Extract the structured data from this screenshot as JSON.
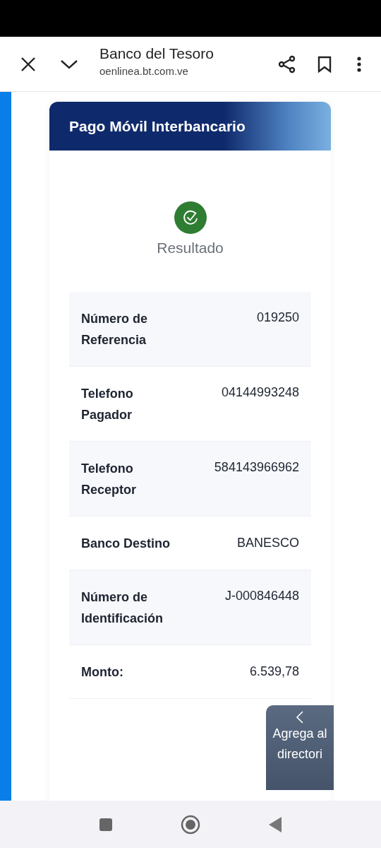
{
  "browser_bar": {
    "title": "Banco del Tesoro",
    "url": "oenlinea.bt.com.ve"
  },
  "card": {
    "title": "Pago Móvil Interbancario",
    "result_label": "Resultado",
    "rows": [
      {
        "label": "Número de Referencia",
        "value": "019250"
      },
      {
        "label": "Telefono Pagador",
        "value": "04144993248"
      },
      {
        "label": "Telefono Receptor",
        "value": "584143966962"
      },
      {
        "label": "Banco Destino",
        "value": "BANESCO"
      },
      {
        "label": "Número de Identificación",
        "value": "J-000846448"
      },
      {
        "label": "Monto:",
        "value": "6.539,78"
      }
    ]
  },
  "side_button": {
    "label": "Agrega al directori"
  }
}
